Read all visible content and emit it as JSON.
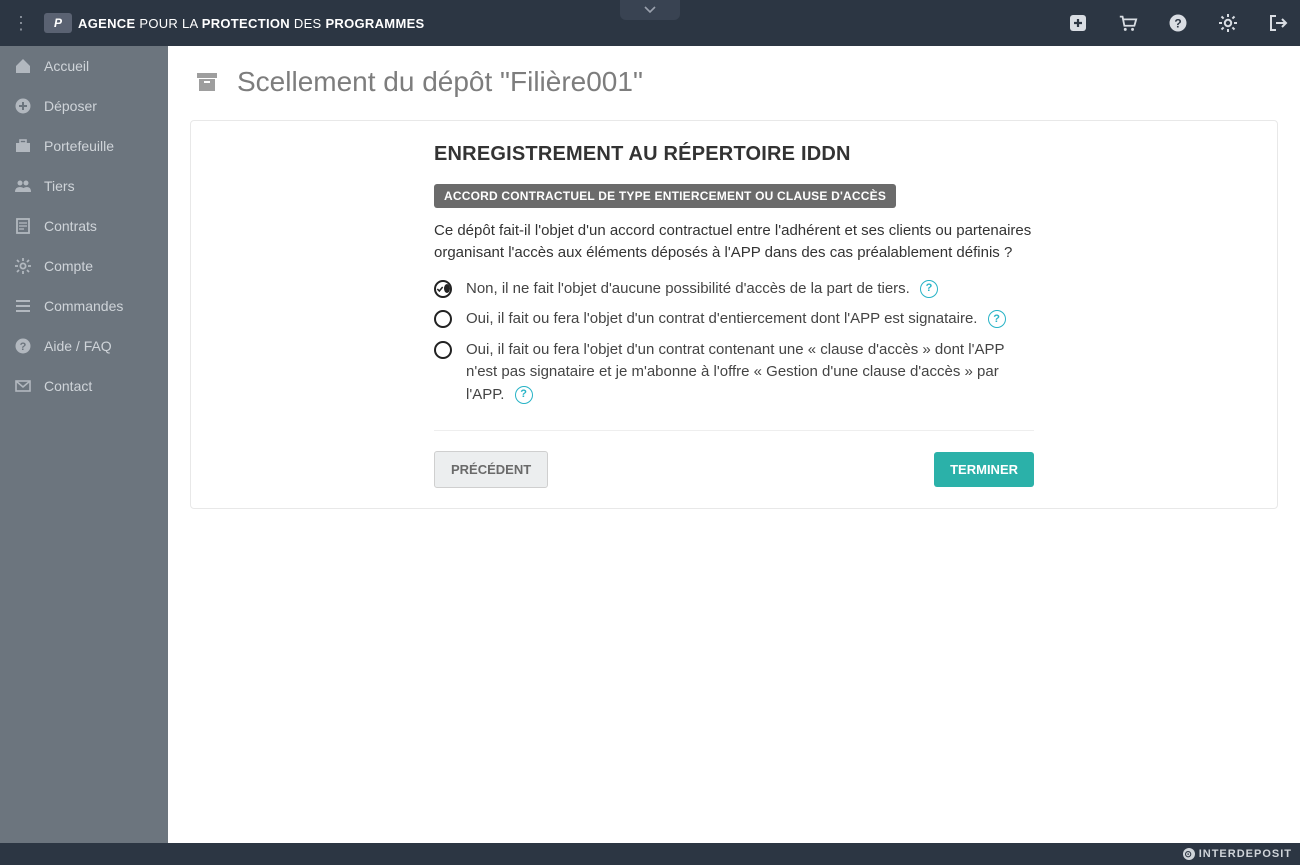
{
  "brand": {
    "prefix": "AGENCE",
    "mid1": "POUR LA",
    "bold": "PROTECTION",
    "mid2": "DES",
    "suffix": "PROGRAMMES"
  },
  "sidebar": {
    "items": [
      {
        "label": "Accueil"
      },
      {
        "label": "Déposer"
      },
      {
        "label": "Portefeuille"
      },
      {
        "label": "Tiers"
      },
      {
        "label": "Contrats"
      },
      {
        "label": "Compte"
      },
      {
        "label": "Commandes"
      },
      {
        "label": "Aide / FAQ"
      },
      {
        "label": "Contact"
      }
    ]
  },
  "page": {
    "title": "Scellement du dépôt \"Filière001\"",
    "section_heading": "ENREGISTREMENT AU RÉPERTOIRE IDDN",
    "badge": "ACCORD CONTRACTUEL DE TYPE ENTIERCEMENT OU CLAUSE D'ACCÈS",
    "question": "Ce dépôt fait-il l'objet d'un accord contractuel entre l'adhérent et ses clients ou partenaires organisant l'accès aux éléments déposés à l'APP dans des cas préalablement définis ?",
    "options": [
      {
        "label": "Non, il ne fait l'objet d'aucune possibilité d'accès de la part de tiers.",
        "selected": true,
        "help": true
      },
      {
        "label": "Oui, il fait ou fera l'objet d'un contrat d'entiercement dont l'APP est signataire.",
        "selected": false,
        "help": true
      },
      {
        "label": "Oui, il fait ou fera l'objet d'un contrat contenant une « clause d'accès » dont l'APP n'est pas signataire et je m'abonne à l'offre « Gestion d'une clause d'accès » par l'APP.",
        "selected": false,
        "help": true
      }
    ],
    "buttons": {
      "prev": "PRÉCÉDENT",
      "finish": "TERMINER"
    }
  },
  "footer": {
    "text": "INTERDEPOSIT"
  }
}
